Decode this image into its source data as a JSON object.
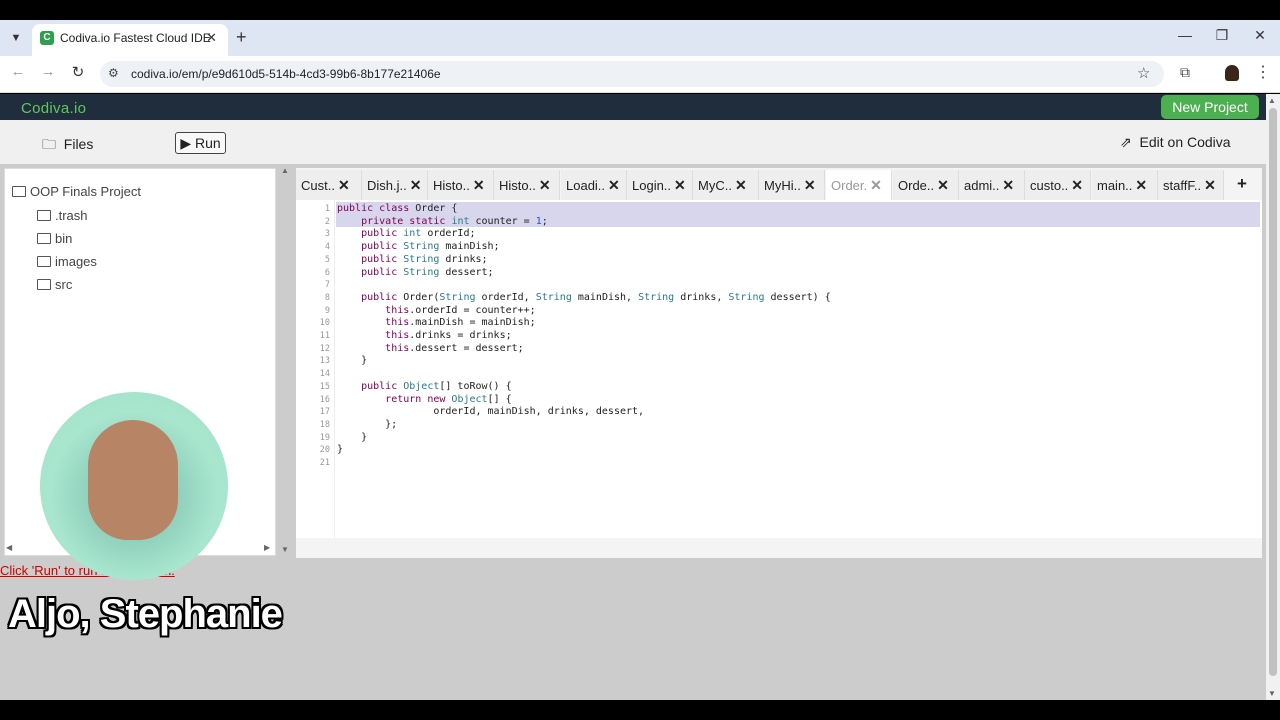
{
  "browser": {
    "tab_title": "Codiva.io Fastest Cloud IDE",
    "url": "codiva.io/em/p/e9d610d5-514b-4cd3-99b6-8b177e21406e"
  },
  "app": {
    "brand": "Codiva.io",
    "new_project": "New Project",
    "files": "Files",
    "run": "Run",
    "edit_on": "Edit on Codiva",
    "run_hint": "Click 'Run' to run the program."
  },
  "tree": {
    "project": "OOP Finals Project",
    "folders": [
      ".trash",
      "bin",
      "images",
      "src"
    ]
  },
  "file_tabs": [
    "Cust..",
    "Dish.j..",
    "Histo..",
    "Histo..",
    "Loadi..",
    "Login..",
    "MyC..",
    "MyHi..",
    "Order.",
    "Orde..",
    "admi..",
    "custo..",
    "main..",
    "staffF.."
  ],
  "active_tab_index": 8,
  "code": [
    "public class Order {",
    "    private static int counter = 1;",
    "    public int orderId;",
    "    public String mainDish;",
    "    public String drinks;",
    "    public String dessert;",
    "",
    "    public Order(String orderId, String mainDish, String drinks, String dessert) {",
    "        this.orderId = counter++;",
    "        this.mainDish = mainDish;",
    "        this.drinks = drinks;",
    "        this.dessert = dessert;",
    "    }",
    "",
    "    public Object[] toRow() {",
    "        return new Object[] {",
    "                orderId, mainDish, drinks, dessert,",
    "        };",
    "    }",
    "}",
    ""
  ],
  "caption": "Aljo, Stephanie",
  "colors": {
    "brand_green": "#5ec85e",
    "header_bg": "#1f2d3d",
    "new_project_bg": "#4caf50",
    "keyword": "#7f0055",
    "type": "#2a7a8a",
    "number": "#1750eb"
  }
}
